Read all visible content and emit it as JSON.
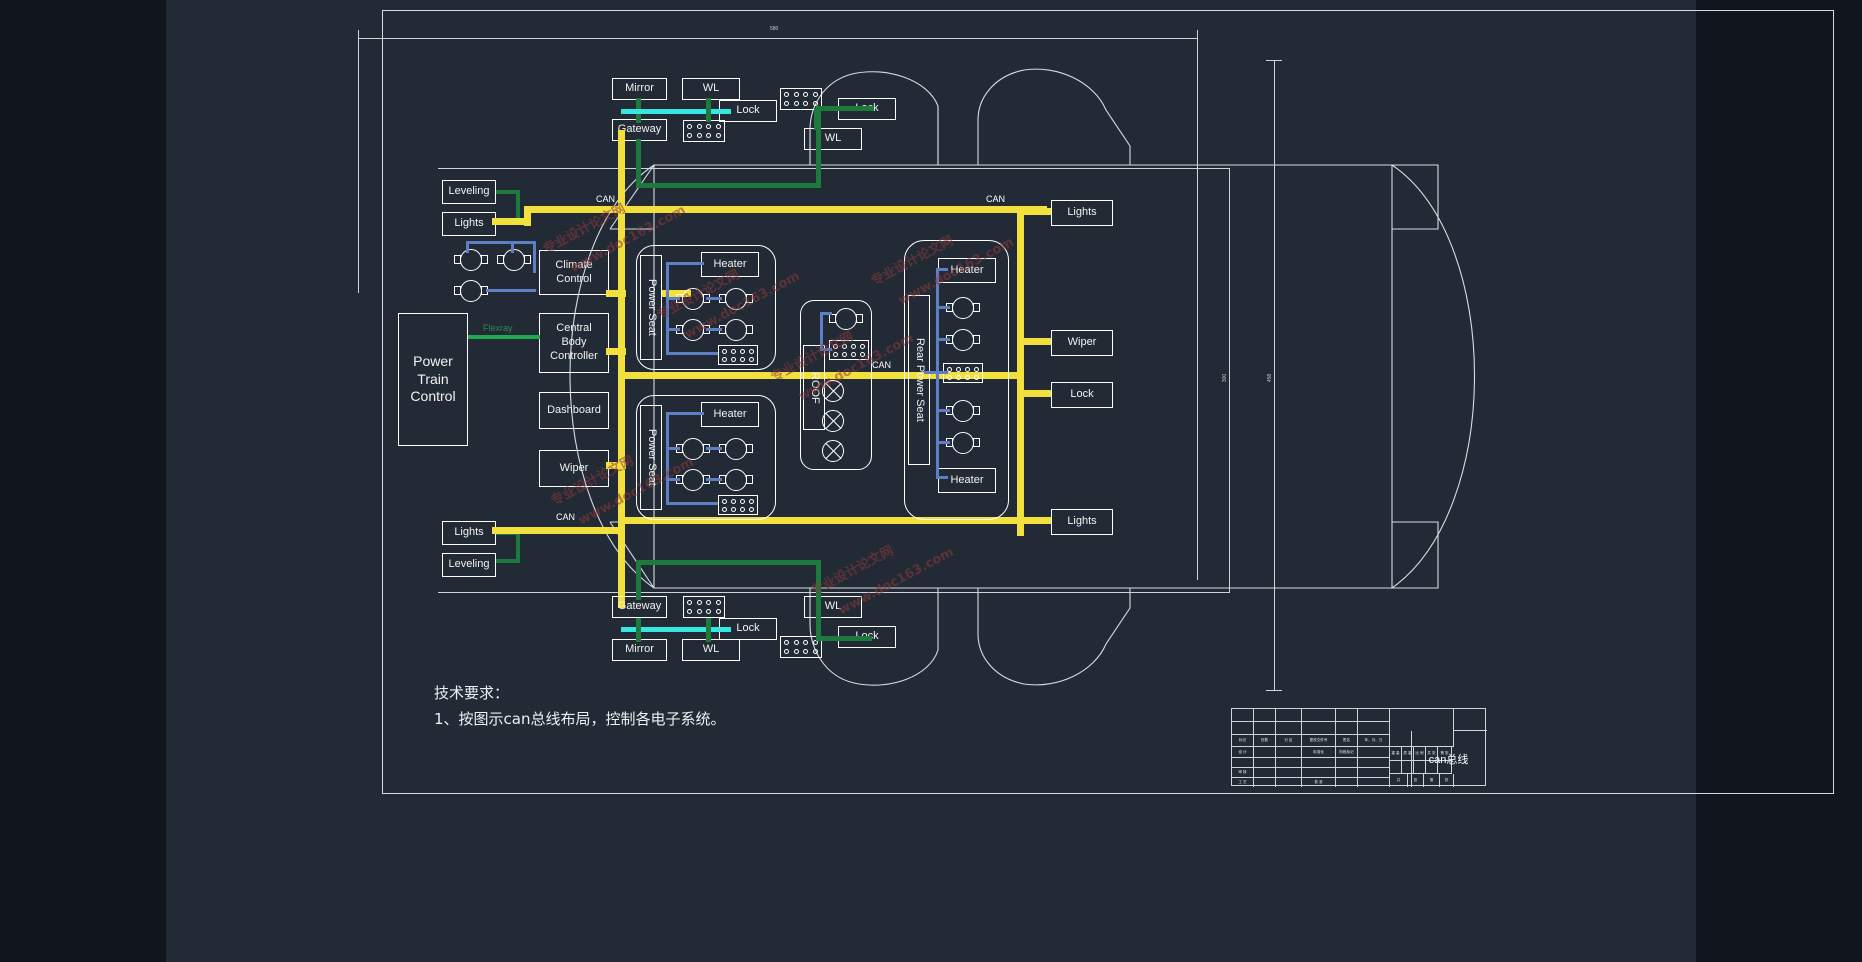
{
  "drawing": {
    "title_cn": "can总线",
    "notes_heading": "技术要求：",
    "notes_line1": "1、按图示can总线布局，控制各电子系统。",
    "dim_top": "580",
    "dim_right": "458",
    "dim_inner_right": "300",
    "colors": {
      "background": "#222a35",
      "gutter": "#11161e",
      "line": "#ffffff",
      "can_bus": "#f2e03c",
      "lin_green": "#1d7a3c",
      "flexray": "#1faa4e",
      "most_cyan": "#38e6e0",
      "lin_blue": "#5f7fc4",
      "watermark": "#8d3a3a"
    }
  },
  "bus_labels": {
    "can_front_left": "CAN",
    "can_front_right": "CAN",
    "can_rear_left": "CAN",
    "can_center_right": "CAN",
    "flexray": "Flexray"
  },
  "modules": {
    "front_left_door": {
      "mirror": "Mirror",
      "wl": "WL",
      "lock": "Lock",
      "gateway": "Gateway"
    },
    "front_right_door": {
      "lock": "Lock",
      "wl": "WL"
    },
    "rear_left_door": {
      "gateway": "Gateway",
      "lock": "Lock",
      "mirror": "Mirror",
      "wl": "WL"
    },
    "rear_right_door": {
      "wl": "WL",
      "lock": "Lock"
    },
    "left_front": {
      "leveling": "Leveling",
      "lights": "Lights"
    },
    "left_rear": {
      "lights": "Lights",
      "leveling": "Leveling"
    },
    "center_column": {
      "climate_control": "Climate\nControl",
      "climate_control_l1": "Climate",
      "climate_control_l2": "Control",
      "central_body_controller_l1": "Central",
      "central_body_controller_l2": "Body",
      "central_body_controller_l3": "Controller",
      "dashboard": "Dashboard",
      "wiper": "Wiper"
    },
    "power_train_control": {
      "l1": "Power",
      "l2": "Train",
      "l3": "Control"
    },
    "front_power_seat": {
      "label": "Power Seat",
      "heater": "Heater"
    },
    "rear_left_power_seat": {
      "label": "Power Seat",
      "heater": "Heater"
    },
    "roof": {
      "label": "ROOF"
    },
    "rear_power_seat": {
      "label": "Rear Power Seat",
      "heater_top": "Heater",
      "heater_bottom": "Heater"
    },
    "right_side": {
      "lights_front": "Lights",
      "wiper": "Wiper",
      "lock": "Lock",
      "lights_rear": "Lights"
    }
  },
  "title_block": {
    "row_headers": [
      "标记",
      "处数",
      "分 区",
      "更改文件号",
      "签名",
      "年、月、日"
    ],
    "row2": [
      "设 计",
      "",
      "",
      "标准化",
      "阶段标记",
      ""
    ],
    "row4": [
      "审 核",
      "",
      "",
      "",
      "",
      ""
    ],
    "row5": [
      "工 艺",
      "",
      "",
      "批 准",
      "",
      ""
    ],
    "mid_headers": [
      "重 量",
      "比 例",
      "共 张",
      "第 张"
    ],
    "mid_sub": [
      "质 量",
      "",
      "",
      ""
    ],
    "mid_bottom": [
      "共",
      "张",
      "第",
      "张"
    ]
  },
  "watermarks": [
    "专业设计论文网",
    "www.doc163.com",
    "专业设计论文网",
    "www.doc163.com",
    "专业设计论文网",
    "www.doc163.com",
    "专业设计论文网",
    "www.doc163.com"
  ]
}
